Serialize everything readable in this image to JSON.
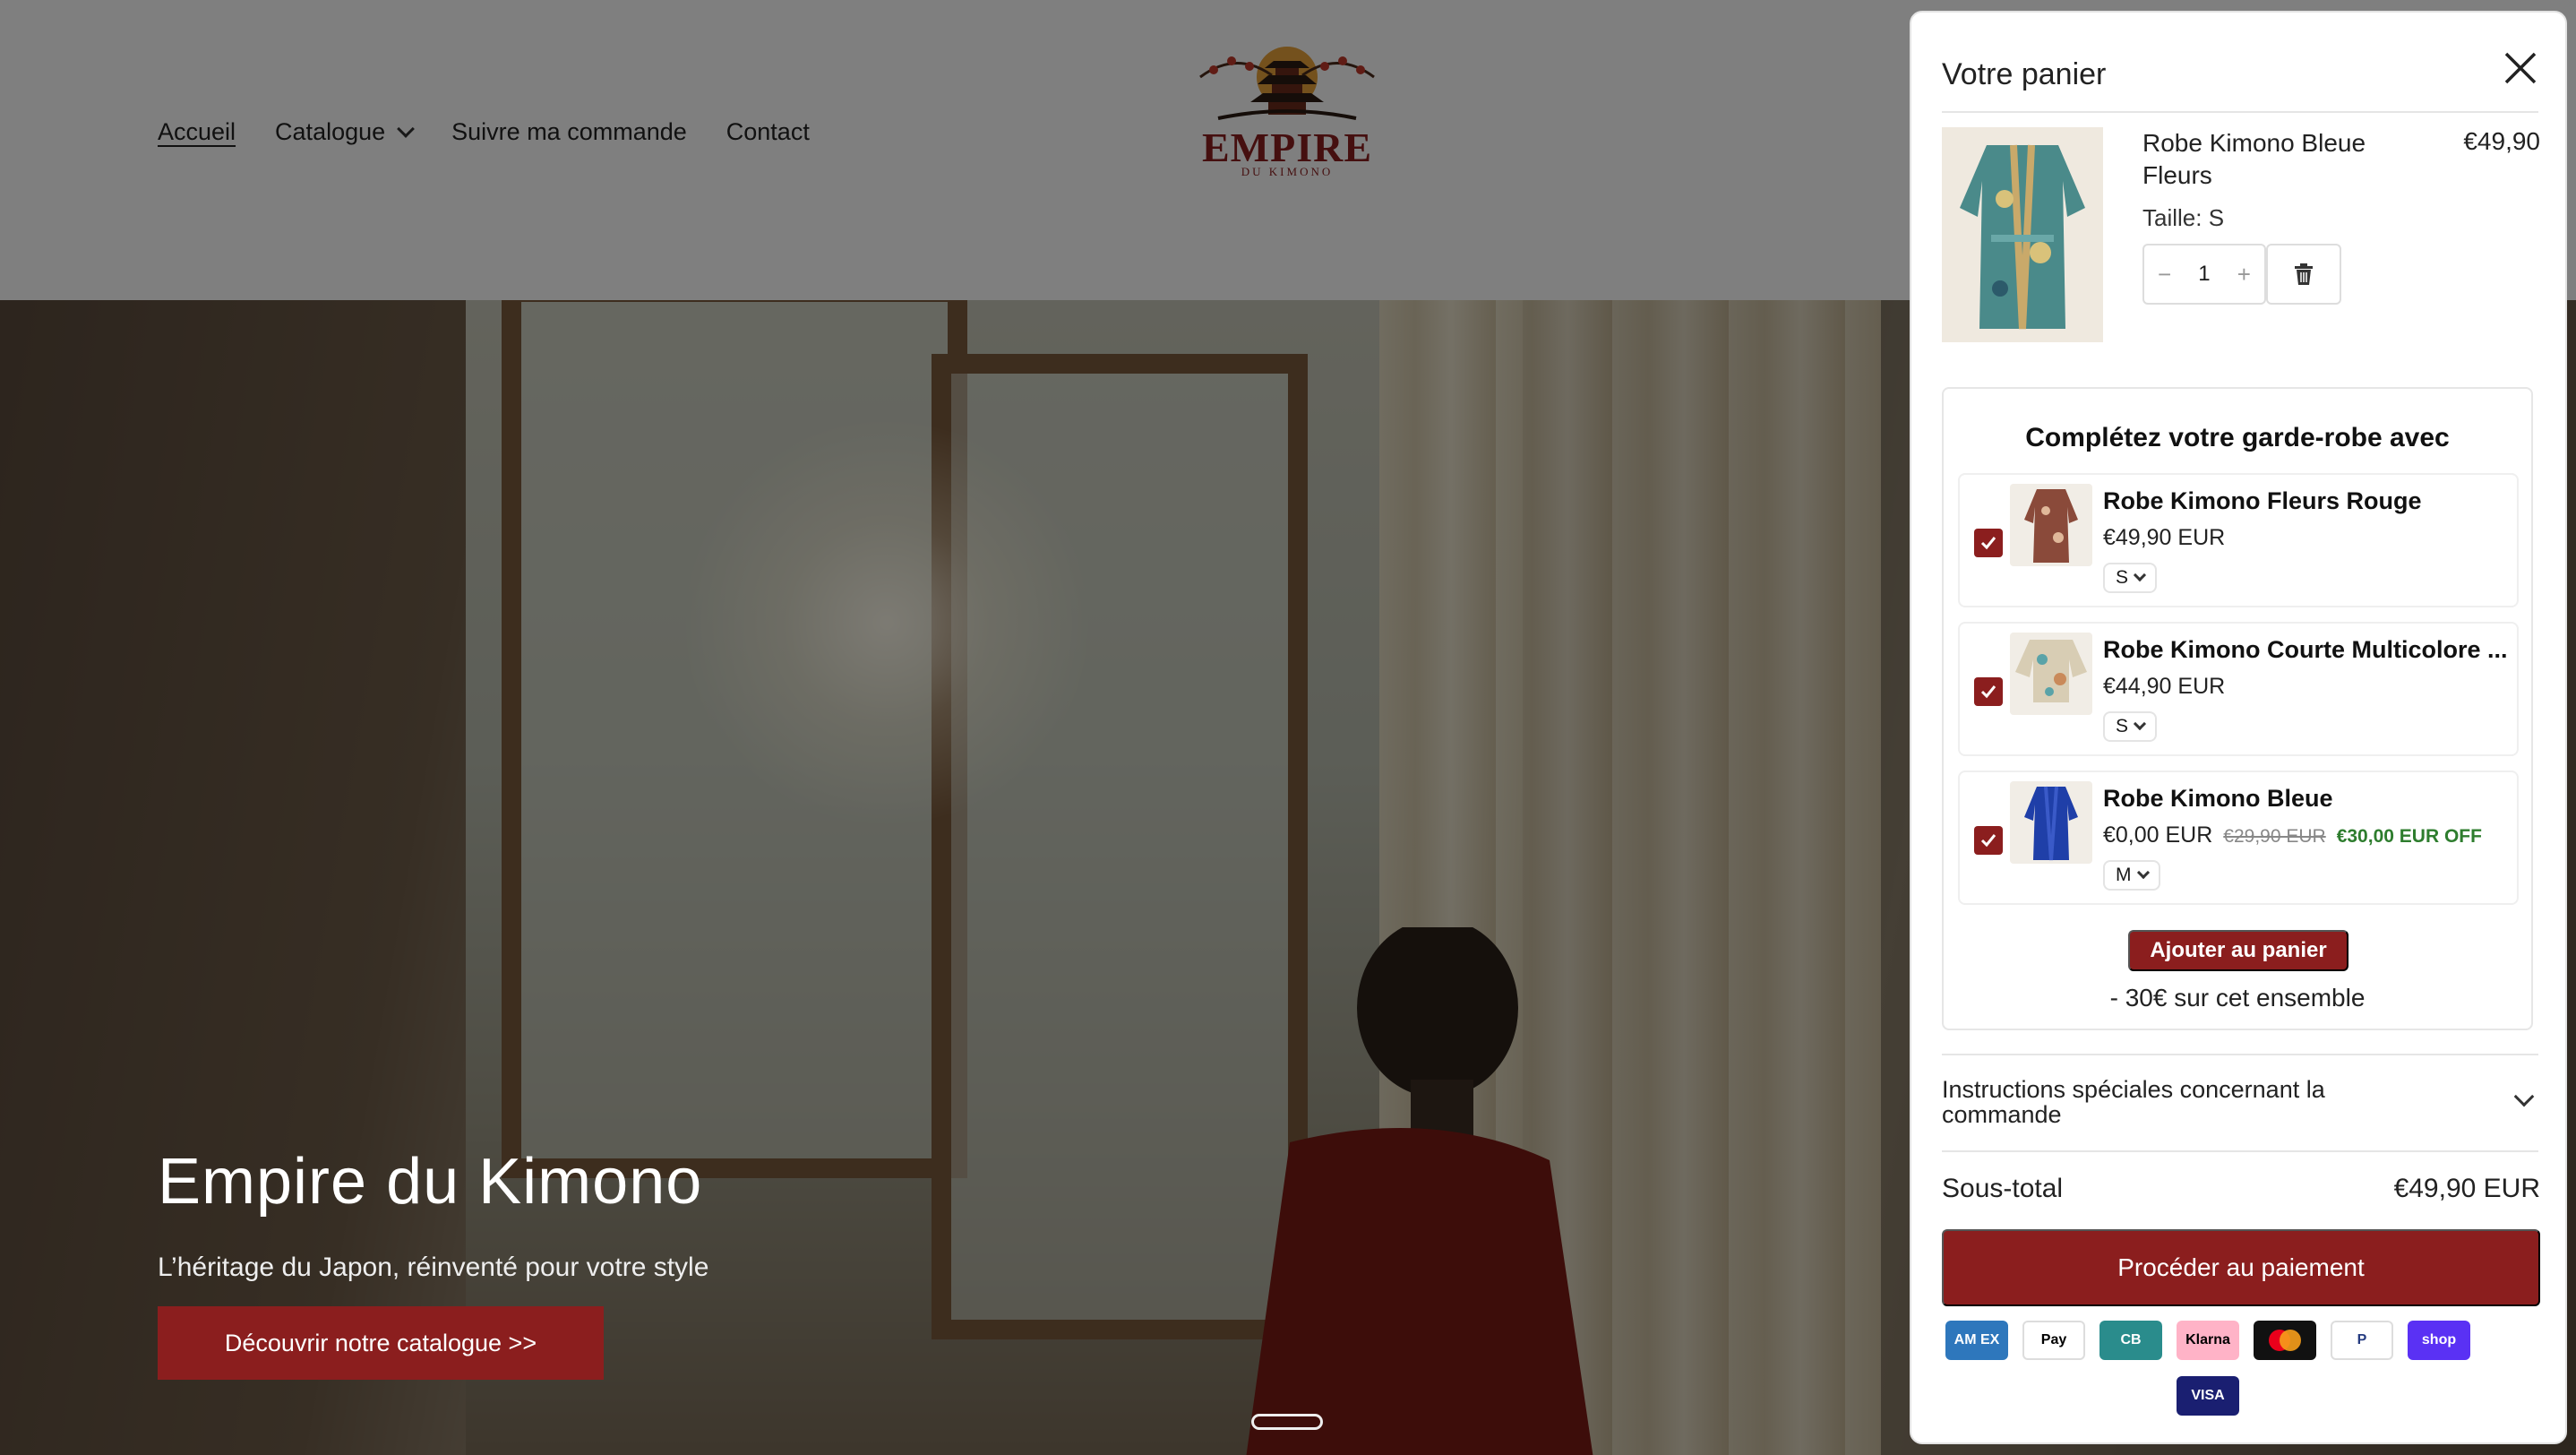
{
  "header": {
    "nav": [
      {
        "label": "Accueil"
      },
      {
        "label": "Catalogue"
      },
      {
        "label": "Suivre ma commande"
      },
      {
        "label": "Contact"
      }
    ],
    "logo": {
      "word": "EMPIRE",
      "sub": "DU KIMONO"
    }
  },
  "hero": {
    "title": "Empire du Kimono",
    "subtitle": "L’héritage du Japon, réinventé pour votre style",
    "button": "Découvrir notre catalogue >>"
  },
  "cart": {
    "title": "Votre panier",
    "item": {
      "name": "Robe Kimono Bleue Fleurs",
      "price": "€49,90",
      "size": "Taille: S",
      "quantity": "1"
    },
    "upsell": {
      "title": "Complétez votre garde-robe avec",
      "products": [
        {
          "name": "Robe Kimono Fleurs Rouge",
          "price": "€49,90 EUR",
          "size": "S",
          "checked": true
        },
        {
          "name": "Robe Kimono Courte Multicolore ...",
          "price": "€44,90 EUR",
          "size": "S",
          "checked": true
        },
        {
          "name": "Robe Kimono Bleue",
          "price": "€0,00 EUR",
          "compare_price": "€29,90 EUR",
          "discount": "€30,00 EUR OFF",
          "size": "M",
          "checked": true
        }
      ],
      "add_button": "Ajouter au panier",
      "bundle_note": "- 30€ sur cet ensemble"
    },
    "instructions": "Instructions spéciales concernant la commande",
    "subtotal_label": "Sous-total",
    "subtotal_value": "€49,90 EUR",
    "checkout": "Procéder au paiement",
    "payment_methods": [
      {
        "label": "AM EX",
        "icon": "amex-icon",
        "bg": "#2e77bc",
        "fg": "#ffffff"
      },
      {
        "label": "Pay",
        "icon": "apple-pay-icon",
        "bg": "#ffffff",
        "fg": "#000000"
      },
      {
        "label": "CB",
        "icon": "cb-icon",
        "bg": "#2a8c8c",
        "fg": "#ffffff"
      },
      {
        "label": "Klarna",
        "icon": "klarna-icon",
        "bg": "#ffb3c7",
        "fg": "#000000"
      },
      {
        "label": "",
        "icon": "mastercard-icon",
        "bg": "#111111",
        "fg": "#ffffff"
      },
      {
        "label": "P",
        "icon": "paypal-icon",
        "bg": "#ffffff",
        "fg": "#253b80"
      },
      {
        "label": "shop",
        "icon": "shop-pay-icon",
        "bg": "#5a31f4",
        "fg": "#ffffff"
      },
      {
        "label": "VISA",
        "icon": "visa-icon",
        "bg": "#1a1f71",
        "fg": "#ffffff"
      }
    ]
  },
  "colors": {
    "brand": "#8b1e1e",
    "success": "#2e7d2e"
  }
}
